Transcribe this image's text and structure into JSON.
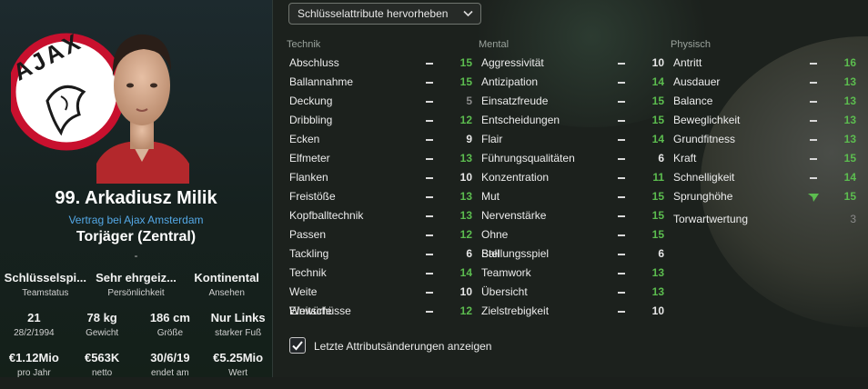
{
  "player": {
    "name": "99. Arkadiusz Milik",
    "contract": "Vertrag bei Ajax Amsterdam",
    "position": "Torjäger (Zentral)",
    "dash": "-"
  },
  "info_rows": [
    [
      {
        "value": "Schlüsselspi...",
        "label": "Teamstatus"
      },
      {
        "value": "Sehr ehrgeiz...",
        "label": "Persönlichkeit"
      },
      {
        "value": "Kontinental",
        "label": "Ansehen"
      }
    ],
    [
      {
        "value": "21",
        "label": "28/2/1994"
      },
      {
        "value": "78 kg",
        "label": "Gewicht"
      },
      {
        "value": "186 cm",
        "label": "Größe"
      },
      {
        "value": "Nur Links",
        "label": "starker Fuß"
      }
    ],
    [
      {
        "value": "€1.12Mio",
        "label": "pro Jahr"
      },
      {
        "value": "€563K",
        "label": "netto"
      },
      {
        "value": "30/6/19",
        "label": "endet am"
      },
      {
        "value": "€5.25Mio",
        "label": "Wert"
      }
    ]
  ],
  "club_logo_text": "AJAX",
  "dropdown": {
    "label": "Schlüsselattribute hervorheben"
  },
  "colors": {
    "key_attribute": "#5cbd4f",
    "normal_attribute": "#e8e8e8",
    "dim_attribute": "#8a8a8a",
    "link": "#54a8e6"
  },
  "columns": [
    {
      "title": "Technik",
      "attributes": [
        {
          "name": "Abschluss",
          "value": "15",
          "trend": "flat",
          "key": true
        },
        {
          "name": "Ballannahme",
          "value": "15",
          "trend": "flat",
          "key": true
        },
        {
          "name": "Deckung",
          "value": "5",
          "trend": "flat",
          "dim": true
        },
        {
          "name": "Dribbling",
          "value": "12",
          "trend": "flat",
          "key": true
        },
        {
          "name": "Ecken",
          "value": "9",
          "trend": "flat"
        },
        {
          "name": "Elfmeter",
          "value": "13",
          "trend": "flat",
          "key": true
        },
        {
          "name": "Flanken",
          "value": "10",
          "trend": "flat"
        },
        {
          "name": "Freistöße",
          "value": "13",
          "trend": "flat",
          "key": true
        },
        {
          "name": "Kopfballtechnik",
          "value": "13",
          "trend": "flat",
          "key": true
        },
        {
          "name": "Passen",
          "value": "12",
          "trend": "flat",
          "key": true
        },
        {
          "name": "Tackling",
          "value": "6",
          "trend": "flat"
        },
        {
          "name": "Technik",
          "value": "14",
          "trend": "flat",
          "key": true
        },
        {
          "name": "Weite Einwürfe",
          "value": "10",
          "trend": "flat"
        },
        {
          "name": "Weitschüsse",
          "value": "12",
          "trend": "flat",
          "key": true
        }
      ]
    },
    {
      "title": "Mental",
      "attributes": [
        {
          "name": "Aggressivität",
          "value": "10",
          "trend": "flat"
        },
        {
          "name": "Antizipation",
          "value": "14",
          "trend": "flat",
          "key": true
        },
        {
          "name": "Einsatzfreude",
          "value": "15",
          "trend": "flat",
          "key": true
        },
        {
          "name": "Entscheidungen",
          "value": "15",
          "trend": "flat",
          "key": true
        },
        {
          "name": "Flair",
          "value": "14",
          "trend": "flat",
          "key": true
        },
        {
          "name": "Führungsqualitäten",
          "value": "6",
          "trend": "flat"
        },
        {
          "name": "Konzentration",
          "value": "11",
          "trend": "flat",
          "key": true
        },
        {
          "name": "Mut",
          "value": "15",
          "trend": "flat",
          "key": true
        },
        {
          "name": "Nervenstärke",
          "value": "15",
          "trend": "flat",
          "key": true
        },
        {
          "name": "Ohne Ball",
          "value": "15",
          "trend": "flat",
          "key": true
        },
        {
          "name": "Stellungsspiel",
          "value": "6",
          "trend": "flat"
        },
        {
          "name": "Teamwork",
          "value": "13",
          "trend": "flat",
          "key": true
        },
        {
          "name": "Übersicht",
          "value": "13",
          "trend": "flat",
          "key": true
        },
        {
          "name": "Zielstrebigkeit",
          "value": "10",
          "trend": "flat"
        }
      ]
    },
    {
      "title": "Physisch",
      "attributes": [
        {
          "name": "Antritt",
          "value": "16",
          "trend": "flat",
          "key": true
        },
        {
          "name": "Ausdauer",
          "value": "13",
          "trend": "flat",
          "key": true
        },
        {
          "name": "Balance",
          "value": "13",
          "trend": "flat",
          "key": true
        },
        {
          "name": "Beweglichkeit",
          "value": "13",
          "trend": "flat",
          "key": true
        },
        {
          "name": "Grundfitness",
          "value": "13",
          "trend": "flat",
          "key": true
        },
        {
          "name": "Kraft",
          "value": "15",
          "trend": "flat",
          "key": true
        },
        {
          "name": "Schnelligkeit",
          "value": "14",
          "trend": "flat",
          "key": true
        },
        {
          "name": "Sprunghöhe",
          "value": "15",
          "trend": "up",
          "key": true
        }
      ],
      "extra": {
        "name": "Torwartwertung",
        "value": "3"
      }
    }
  ],
  "checkbox": {
    "label": "Letzte Attributsänderungen anzeigen",
    "checked": true
  }
}
